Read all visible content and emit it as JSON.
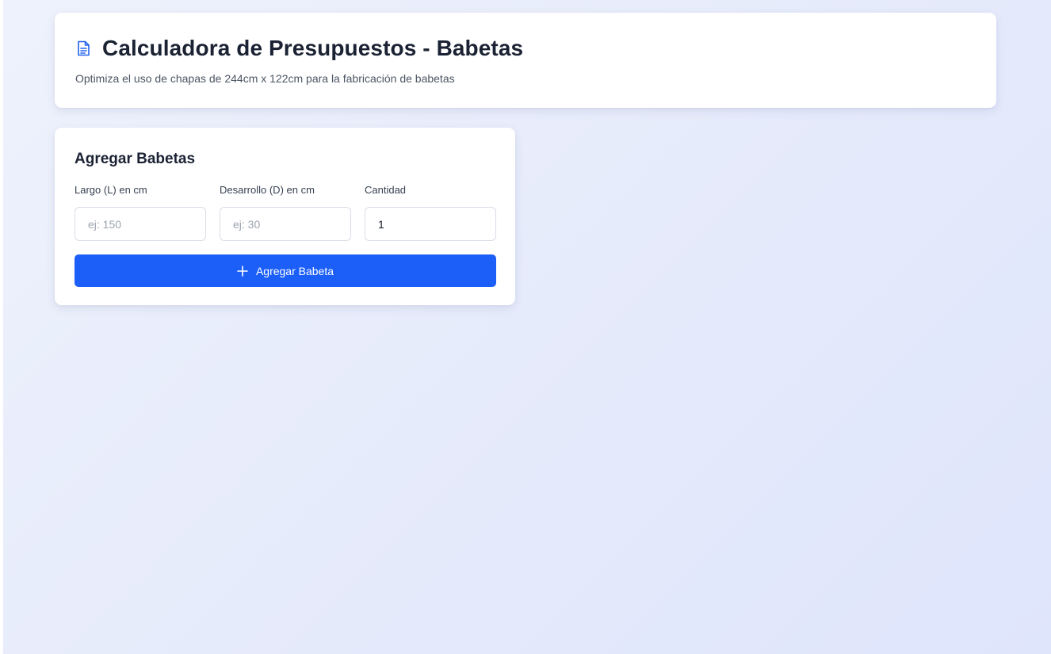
{
  "header": {
    "title": "Calculadora de Presupuestos - Babetas",
    "subtitle": "Optimiza el uso de chapas de 244cm x 122cm para la fabricación de babetas",
    "icon": "document-icon"
  },
  "form": {
    "title": "Agregar Babetas",
    "fields": [
      {
        "label": "Largo (L) en cm",
        "placeholder": "ej: 150",
        "value": ""
      },
      {
        "label": "Desarrollo (D) en cm",
        "placeholder": "ej: 30",
        "value": ""
      },
      {
        "label": "Cantidad",
        "placeholder": "",
        "value": "1"
      }
    ],
    "add_button_label": "Agregar Babeta",
    "add_button_icon": "plus-icon"
  },
  "colors": {
    "accent": "#1c5ff8",
    "icon": "#2563eb",
    "title_text": "#1a2233"
  }
}
